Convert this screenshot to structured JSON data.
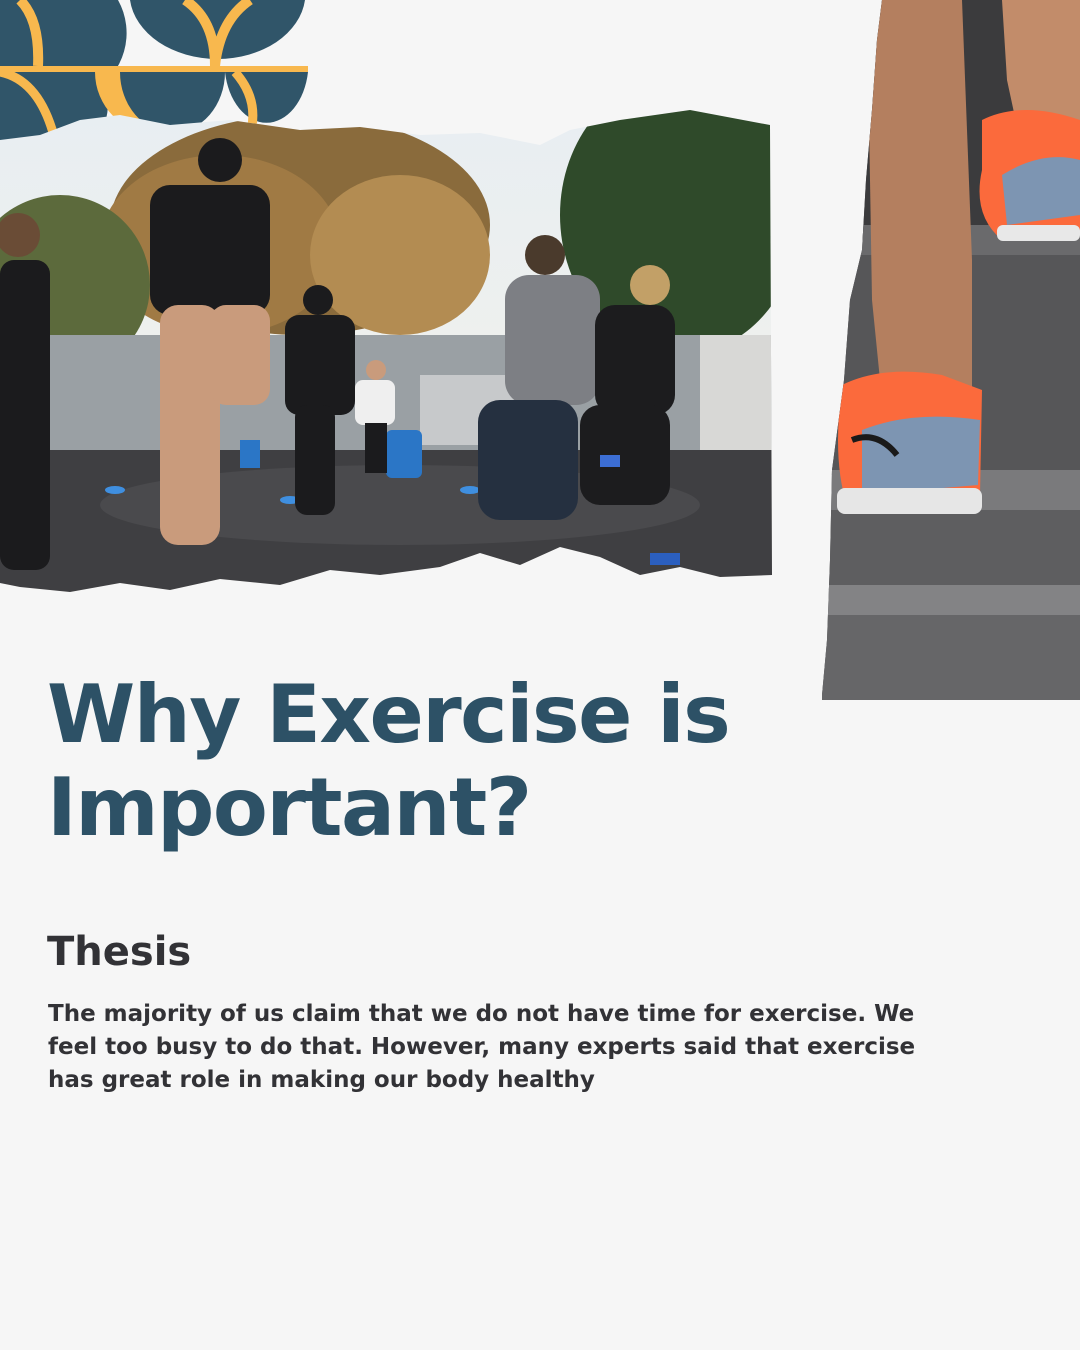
{
  "colors": {
    "background": "#f6f6f6",
    "title": "#2d5166",
    "text": "#323236",
    "deco_teal": "#305569",
    "deco_yellow": "#f8b84e",
    "shoe_orange": "#fb6a3c"
  },
  "images": {
    "group": {
      "icon": "group-outdoor-exercise-photo"
    },
    "stairs": {
      "icon": "running-shoes-on-stairs-photo"
    },
    "decoration": {
      "icon": "semicircle-pattern-icon"
    }
  },
  "title": "Why Exercise is Important?",
  "subtitle": "Thesis",
  "body": "The majority of us claim that we do not have time for exercise. We feel too busy to do that. However, many experts said that exercise has great role in making our body healthy"
}
